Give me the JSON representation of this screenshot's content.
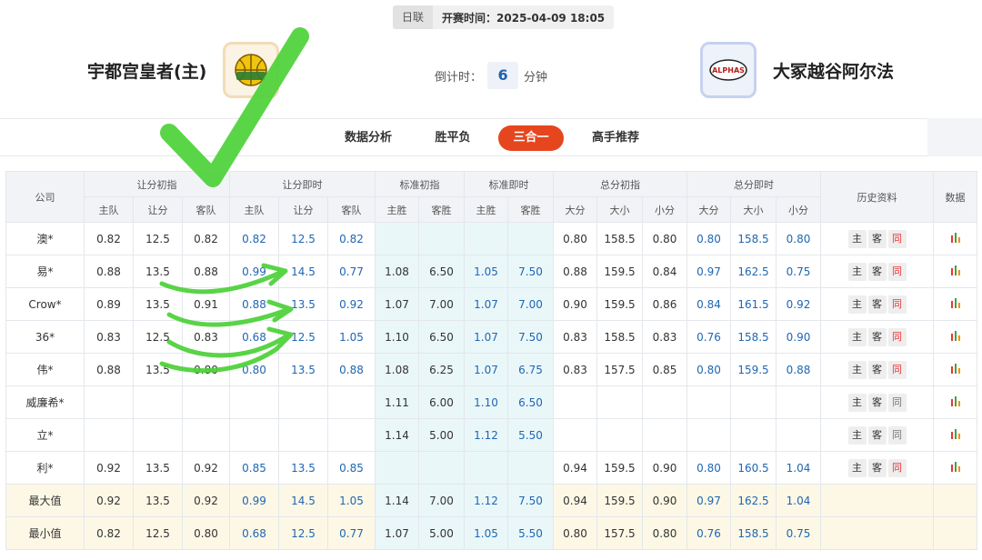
{
  "match": {
    "league": "日联",
    "start_time": "开赛时间：2025-04-09 18:05"
  },
  "home": {
    "name": "宇都宫皇者(主)"
  },
  "away": {
    "name": "大冢越谷阿尔法",
    "logo_text": "ALPHAS"
  },
  "countdown": {
    "label": "倒计时：",
    "value": "6",
    "unit": "分钟"
  },
  "tabs": [
    "数据分析",
    "胜平负",
    "三合一",
    "高手推荐"
  ],
  "active_tab": "三合一",
  "table": {
    "groups": [
      "公司",
      "让分初指",
      "让分即时",
      "标准初指",
      "标准即时",
      "总分初指",
      "总分即时",
      "历史资料",
      "数据"
    ],
    "subheaders": [
      "主队",
      "让分",
      "客队",
      "主队",
      "让分",
      "客队",
      "主胜",
      "客胜",
      "主胜",
      "客胜",
      "大分",
      "大小",
      "小分",
      "大分",
      "大小",
      "小分"
    ],
    "history_buttons": [
      "主",
      "客",
      "同"
    ],
    "rows": [
      {
        "company": "澳*",
        "cells": [
          "0.82",
          "12.5",
          "0.82",
          "0.82",
          "12.5",
          "0.82",
          "",
          "",
          "",
          "",
          "0.80",
          "158.5",
          "0.80",
          "0.80",
          "158.5",
          "0.80"
        ],
        "same_active": true
      },
      {
        "company": "易*",
        "cells": [
          "0.88",
          "13.5",
          "0.88",
          "0.99",
          "14.5",
          "0.77",
          "1.08",
          "6.50",
          "1.05",
          "7.50",
          "0.88",
          "159.5",
          "0.84",
          "0.97",
          "162.5",
          "0.75"
        ],
        "same_active": true
      },
      {
        "company": "Crow*",
        "cells": [
          "0.89",
          "13.5",
          "0.91",
          "0.88",
          "13.5",
          "0.92",
          "1.07",
          "7.00",
          "1.07",
          "7.00",
          "0.90",
          "159.5",
          "0.86",
          "0.84",
          "161.5",
          "0.92"
        ],
        "same_active": true
      },
      {
        "company": "36*",
        "cells": [
          "0.83",
          "12.5",
          "0.83",
          "0.68",
          "12.5",
          "1.05",
          "1.10",
          "6.50",
          "1.07",
          "7.50",
          "0.83",
          "158.5",
          "0.83",
          "0.76",
          "158.5",
          "0.90"
        ],
        "same_active": true
      },
      {
        "company": "伟*",
        "cells": [
          "0.88",
          "13.5",
          "0.80",
          "0.80",
          "13.5",
          "0.88",
          "1.08",
          "6.25",
          "1.07",
          "6.75",
          "0.83",
          "157.5",
          "0.85",
          "0.80",
          "159.5",
          "0.88"
        ],
        "same_active": true
      },
      {
        "company": "威廉希*",
        "cells": [
          "",
          "",
          "",
          "",
          "",
          "",
          "1.11",
          "6.00",
          "1.10",
          "6.50",
          "",
          "",
          "",
          "",
          "",
          ""
        ],
        "same_active": false
      },
      {
        "company": "立*",
        "cells": [
          "",
          "",
          "",
          "",
          "",
          "",
          "1.14",
          "5.00",
          "1.12",
          "5.50",
          "",
          "",
          "",
          "",
          "",
          ""
        ],
        "same_active": false
      },
      {
        "company": "利*",
        "cells": [
          "0.92",
          "13.5",
          "0.92",
          "0.85",
          "13.5",
          "0.85",
          "",
          "",
          "",
          "",
          "0.94",
          "159.5",
          "0.90",
          "0.80",
          "160.5",
          "1.04"
        ],
        "same_active": true
      }
    ],
    "stats": [
      {
        "label": "最大值",
        "cells": [
          "0.92",
          "13.5",
          "0.92",
          "0.99",
          "14.5",
          "1.05",
          "1.14",
          "7.00",
          "1.12",
          "7.50",
          "0.94",
          "159.5",
          "0.90",
          "0.97",
          "162.5",
          "1.04"
        ]
      },
      {
        "label": "最小值",
        "cells": [
          "0.82",
          "12.5",
          "0.80",
          "0.68",
          "12.5",
          "0.77",
          "1.07",
          "5.00",
          "1.05",
          "5.50",
          "0.80",
          "157.5",
          "0.80",
          "0.76",
          "158.5",
          "0.75"
        ]
      }
    ]
  },
  "colors": {
    "accent": "#e6461e",
    "blue_values": "#1f66b3",
    "overlay_green": "#4cd137",
    "std_bg": "#eaf7f9",
    "stat_bg": "#fdf8e6"
  },
  "icons": {
    "data_icon": "bar-chart-icon",
    "overlay": "checkmark-icon"
  }
}
